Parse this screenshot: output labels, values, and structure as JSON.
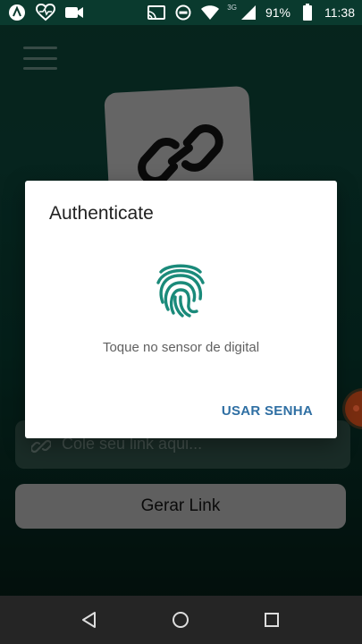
{
  "status_bar": {
    "left_icons": [
      "app-a-icon",
      "heart-pulse-icon",
      "video-camera-icon"
    ],
    "right_icons": [
      "cast-icon",
      "do-not-disturb-icon",
      "wifi-icon",
      "signal-icon",
      "battery-icon"
    ],
    "network_type": "3G",
    "battery": "91%",
    "time": "11:38"
  },
  "app": {
    "menu_icon": "hamburger-menu-icon",
    "hero_icon": "link-chain-icon",
    "link_input": {
      "icon": "link-icon",
      "placeholder": "Cole seu link aqui..."
    },
    "generate_button": "Gerar Link"
  },
  "dialog": {
    "title": "Authenticate",
    "icon": "fingerprint-icon",
    "message": "Toque no sensor de digital",
    "action": "USAR SENHA"
  },
  "colors": {
    "background_top": "#0b3a2e",
    "accent_teal": "#1a8a7a",
    "action_blue": "#2f6fa3",
    "nav_bar": "#252525"
  },
  "nav_bar": {
    "back_icon": "back-triangle-icon",
    "home_icon": "home-circle-icon",
    "recents_icon": "recents-square-icon"
  }
}
